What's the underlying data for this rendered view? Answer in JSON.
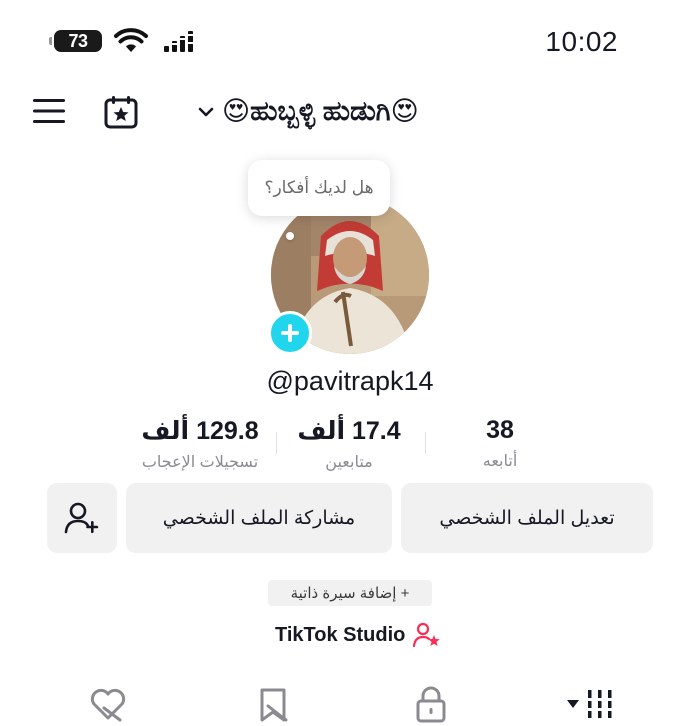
{
  "status_bar": {
    "battery": "73",
    "time": "10:02"
  },
  "header": {
    "title": "😍ಹುಬ್ಬಳ್ಳಿ ಹುಡುಗಿ😍",
    "menu_icon": "hamburger-icon",
    "calendar_icon": "calendar-star-icon"
  },
  "avatar": {
    "bubble_text": "هل لديك أفكار؟"
  },
  "username": "@pavitrapk14",
  "stats": {
    "likes": {
      "value": "129.8 ألف",
      "label": "تسجيلات الإعجاب"
    },
    "followers": {
      "value": "17.4 ألف",
      "label": "متابعين"
    },
    "following": {
      "value": "38",
      "label": "أتابعه"
    }
  },
  "buttons": {
    "edit_profile": "تعديل الملف الشخصي",
    "share_profile": "مشاركة الملف الشخصي"
  },
  "bio_button": "+ إضافة سيرة ذاتية",
  "studio": {
    "label": "TikTok Studio"
  },
  "colors": {
    "accent": "#20d5ec",
    "studio_icon": "#fe2c55"
  }
}
